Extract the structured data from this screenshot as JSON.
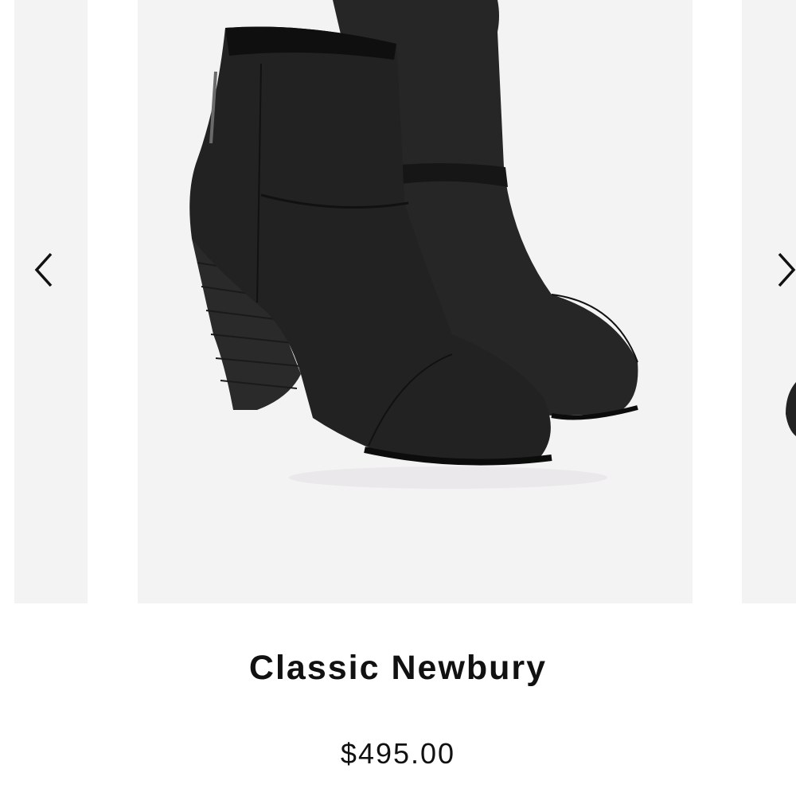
{
  "carousel": {
    "prev_icon": "chevron-left-icon",
    "next_icon": "chevron-right-icon"
  },
  "product": {
    "name": "Classic Newbury",
    "price": "$495.00",
    "image_subject": "black-leather-ankle-boots"
  },
  "colors": {
    "card_background": "#f4f3f4",
    "boot": "#1e1e1e",
    "text": "#111111"
  }
}
